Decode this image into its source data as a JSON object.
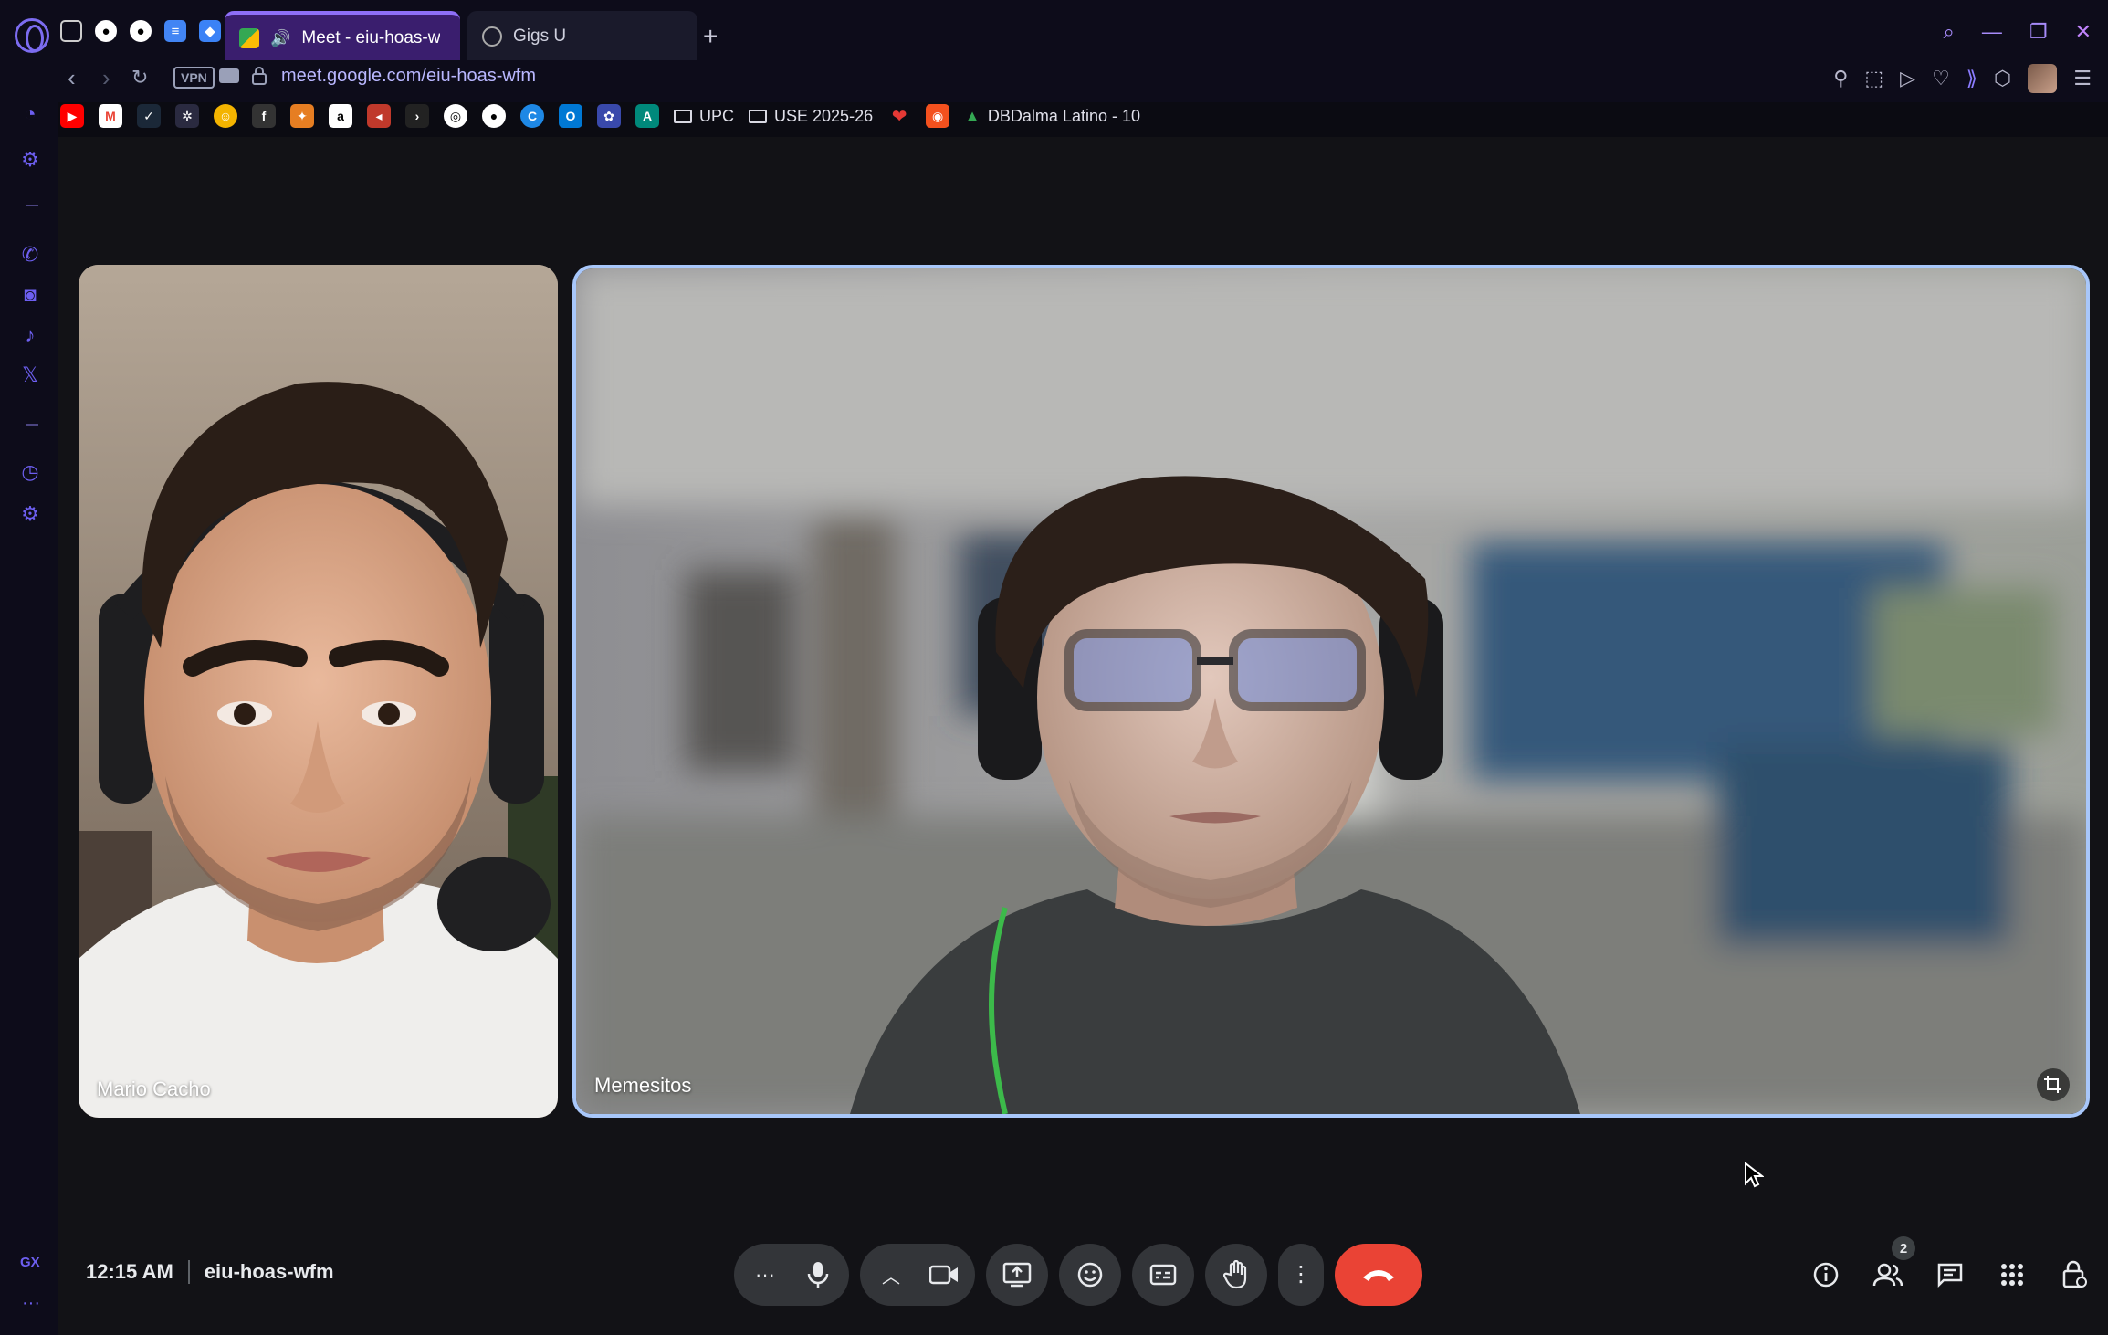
{
  "browser": {
    "tabs": [
      {
        "label": "Meet - eiu-hoas-w",
        "active": true
      },
      {
        "label": "Gigs U",
        "active": false
      }
    ],
    "new_tab_icon": "plus-icon",
    "vpn_label": "VPN",
    "url": "meet.google.com/eiu-hoas-wfm",
    "bookmarks": {
      "folder_upc": "UPC",
      "folder_use": "USE 2025-26",
      "last": "DBDalma Latino - 10"
    }
  },
  "meet": {
    "participants": [
      {
        "name": "Mario Cacho"
      },
      {
        "name": "Memesitos"
      }
    ],
    "time": "12:15 AM",
    "meeting_code": "eiu-hoas-wfm",
    "people_count": "2",
    "colors": {
      "end_call": "#ea4335",
      "active_tile_border": "#a8c7fa",
      "control_bg": "#333539"
    }
  }
}
